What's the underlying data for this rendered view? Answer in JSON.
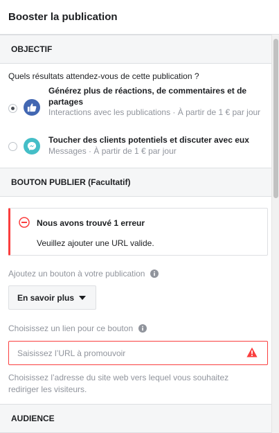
{
  "header": {
    "title": "Booster la publication"
  },
  "objective": {
    "section_label": "OBJECTIF",
    "question": "Quels résultats attendez-vous de cette publication ?",
    "options": [
      {
        "title": "Générez plus de réactions, de commentaires et de partages",
        "subtitle": "Interactions avec les publications · À partir de 1 € par jour",
        "icon": "thumbs-up-icon",
        "icon_color": "#4267b2",
        "selected": true
      },
      {
        "title": "Toucher des clients potentiels et discuter avec eux",
        "subtitle": "Messages · À partir de 1 € par jour",
        "icon": "messenger-icon",
        "icon_color": "#44bec7",
        "selected": false
      }
    ]
  },
  "publish_button": {
    "section_label": "BOUTON PUBLIER (Facultatif)",
    "error": {
      "title": "Nous avons trouvé 1 erreur",
      "message": "Veuillez ajouter une URL valide.",
      "color": "#fa3e3e"
    },
    "button_label": "Ajoutez un bouton à votre publication",
    "button_value": "En savoir plus",
    "link_label": "Choisissez un lien pour ce bouton",
    "url_placeholder": "Saisissez l’URL à promouvoir",
    "url_value": "",
    "helper": "Choisissez l’adresse du site web vers lequel vous souhaitez rediriger les visiteurs."
  },
  "audience": {
    "section_label": "AUDIENCE"
  }
}
